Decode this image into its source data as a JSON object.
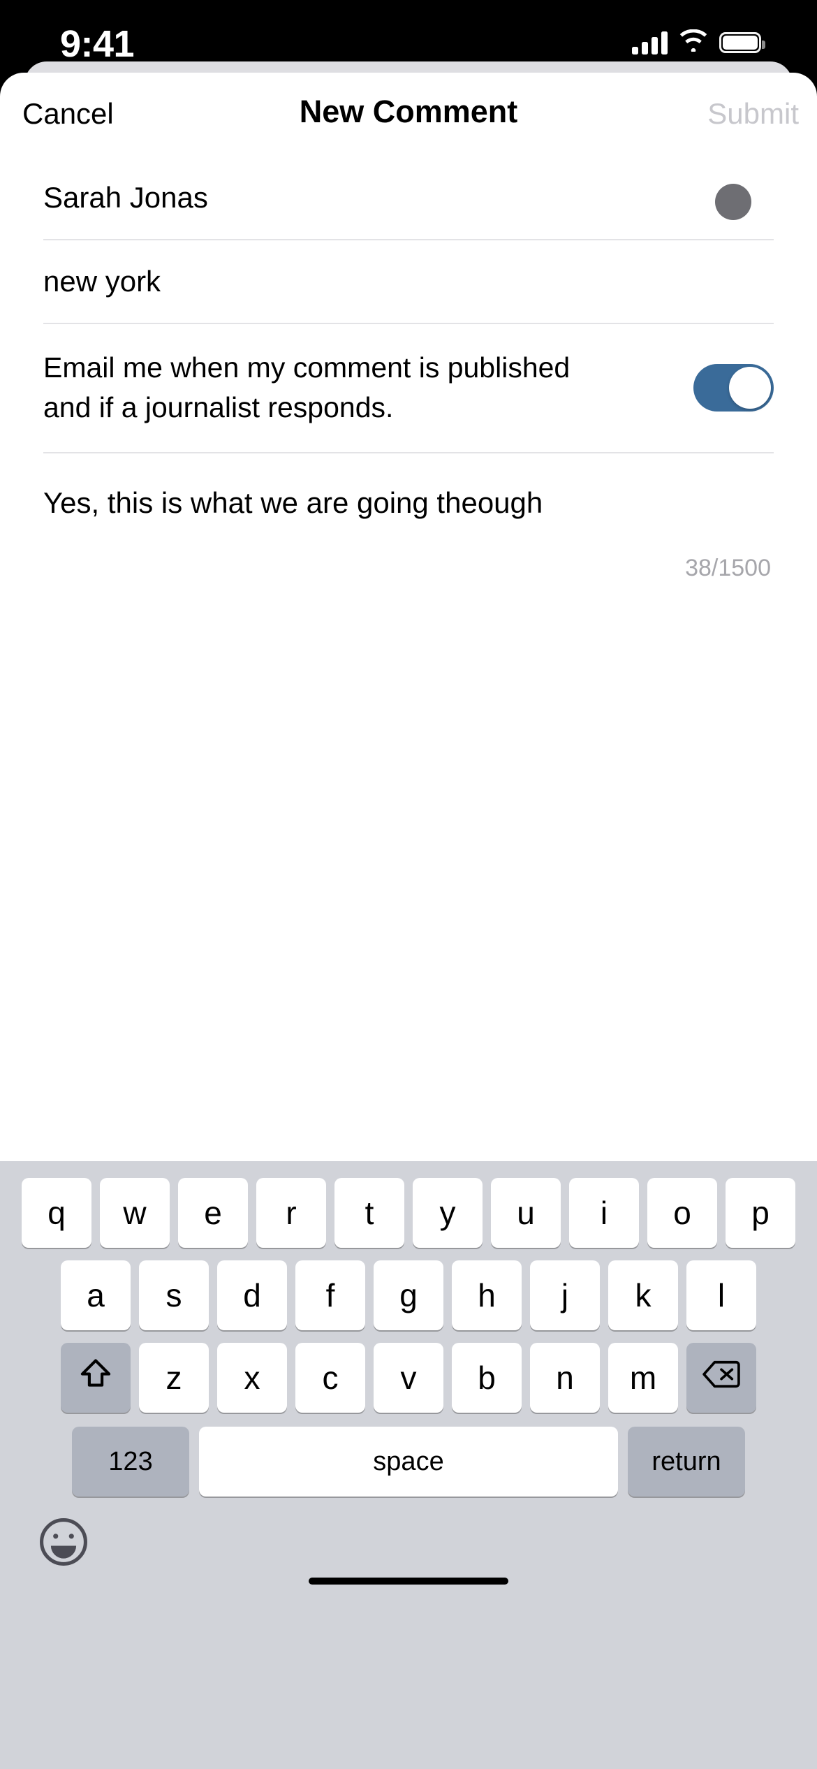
{
  "status_bar": {
    "time": "9:41",
    "icons": [
      "cellular-signal-icon",
      "wifi-icon",
      "battery-icon"
    ]
  },
  "nav": {
    "cancel_label": "Cancel",
    "title": "New Comment",
    "submit_label": "Submit",
    "submit_disabled": true
  },
  "cursor": {
    "visible": true,
    "color": "#6E6E73"
  },
  "form": {
    "name_field": {
      "value": "Sarah Jonas",
      "placeholder": "Name"
    },
    "location_field": {
      "value": "new york",
      "placeholder": "Location"
    },
    "email_toggle": {
      "label": "Email me when my comment is published and if a journalist responds.",
      "on": true,
      "accent": "#3A6B99"
    },
    "comment_field": {
      "value": "Yes, this is what we are going theough",
      "placeholder": "Share your thoughts"
    },
    "counter": "38/1500"
  },
  "keyboard": {
    "row1": [
      "q",
      "w",
      "e",
      "r",
      "t",
      "y",
      "u",
      "i",
      "o",
      "p"
    ],
    "row2": [
      "a",
      "s",
      "d",
      "f",
      "g",
      "h",
      "j",
      "k",
      "l"
    ],
    "row3_letters": [
      "z",
      "x",
      "c",
      "v",
      "b",
      "n",
      "m"
    ],
    "shift_icon": "shift-icon",
    "backspace_icon": "backspace-icon",
    "numbers_label": "123",
    "space_label": "space",
    "return_label": "return",
    "emoji_icon": "emoji-smiley-icon",
    "background": "#D1D3D9",
    "key_background": "#FFFFFF",
    "modifier_background": "#AEB3BE"
  }
}
